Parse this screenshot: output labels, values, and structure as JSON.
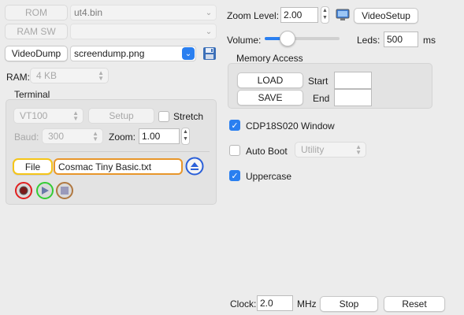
{
  "left": {
    "rom_button": "ROM",
    "rom_file": "ut4.bin",
    "ramsw_button": "RAM SW",
    "ramsw_file": "",
    "videodump_button": "VideoDump",
    "videodump_file": "screendump.png",
    "ram_label": "RAM:",
    "ram_value": "4 KB",
    "terminal": {
      "title": "Terminal",
      "type_value": "VT100",
      "setup_button": "Setup",
      "stretch_label": "Stretch",
      "stretch_checked": false,
      "baud_label": "Baud:",
      "baud_value": "300",
      "zoom_label": "Zoom:",
      "zoom_value": "1.00",
      "file_button": "File",
      "file_name": "Cosmac Tiny Basic.txt"
    }
  },
  "right": {
    "zoom_level_label": "Zoom Level:",
    "zoom_level_value": "2.00",
    "videosetup_button": "VideoSetup",
    "volume_label": "Volume:",
    "volume_fraction": 0.3,
    "leds_label": "Leds:",
    "leds_value": "500",
    "leds_unit": "ms",
    "memory": {
      "title": "Memory Access",
      "load_button": "LOAD",
      "save_button": "SAVE",
      "start_label": "Start",
      "start_value": "",
      "end_label": "End",
      "end_value": ""
    },
    "cdp_window_label": "CDP18S020 Window",
    "cdp_window_checked": true,
    "auto_boot_label": "Auto Boot",
    "auto_boot_checked": false,
    "auto_boot_value": "Utility",
    "uppercase_label": "Uppercase",
    "uppercase_checked": true,
    "clock_label": "Clock:",
    "clock_value": "2.0",
    "clock_unit": "MHz",
    "stop_button": "Stop",
    "reset_button": "Reset"
  },
  "colors": {
    "accent": "#2a7ff0",
    "file_highlight": "#f5c518",
    "filename_highlight": "#e8962a",
    "record": "#e02020",
    "play": "#33cc33",
    "stop": "#b07840"
  },
  "icons": [
    "save-disk-icon",
    "monitor-icon",
    "eject-icon",
    "record-icon",
    "play-icon",
    "stop-icon"
  ]
}
